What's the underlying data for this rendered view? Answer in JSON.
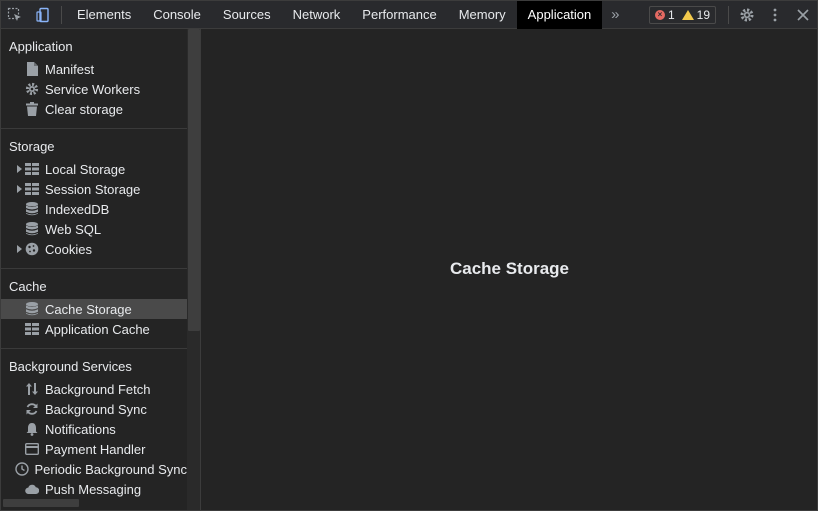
{
  "toolbar": {
    "tabs": [
      {
        "label": "Elements"
      },
      {
        "label": "Console"
      },
      {
        "label": "Sources"
      },
      {
        "label": "Network"
      },
      {
        "label": "Performance"
      },
      {
        "label": "Memory"
      },
      {
        "label": "Application",
        "active": true
      }
    ],
    "more_tabs": "»",
    "errors_count": "1",
    "warnings_count": "19"
  },
  "sidebar": {
    "sections": [
      {
        "title": "Application",
        "items": [
          {
            "label": "Manifest",
            "icon": "document-icon"
          },
          {
            "label": "Service Workers",
            "icon": "gear-icon"
          },
          {
            "label": "Clear storage",
            "icon": "trash-icon"
          }
        ]
      },
      {
        "title": "Storage",
        "items": [
          {
            "label": "Local Storage",
            "icon": "table-icon",
            "expandable": true
          },
          {
            "label": "Session Storage",
            "icon": "table-icon",
            "expandable": true
          },
          {
            "label": "IndexedDB",
            "icon": "database-icon"
          },
          {
            "label": "Web SQL",
            "icon": "database-icon"
          },
          {
            "label": "Cookies",
            "icon": "cookie-icon",
            "expandable": true
          }
        ]
      },
      {
        "title": "Cache",
        "items": [
          {
            "label": "Cache Storage",
            "icon": "database-icon",
            "selected": true
          },
          {
            "label": "Application Cache",
            "icon": "table-icon"
          }
        ]
      },
      {
        "title": "Background Services",
        "items": [
          {
            "label": "Background Fetch",
            "icon": "up-down-arrows-icon"
          },
          {
            "label": "Background Sync",
            "icon": "sync-icon"
          },
          {
            "label": "Notifications",
            "icon": "bell-icon"
          },
          {
            "label": "Payment Handler",
            "icon": "card-icon"
          },
          {
            "label": "Periodic Background Sync",
            "icon": "clock-icon"
          },
          {
            "label": "Push Messaging",
            "icon": "cloud-icon"
          }
        ]
      }
    ]
  },
  "main": {
    "title": "Cache Storage"
  },
  "colors": {
    "panel_bg": "#242424",
    "tabbar_bg": "#292a2d",
    "active_tab_bg": "#000000",
    "selected_item_bg": "#4a4a4a",
    "error_red": "#e46962",
    "warning_yellow": "#f2c94c"
  }
}
